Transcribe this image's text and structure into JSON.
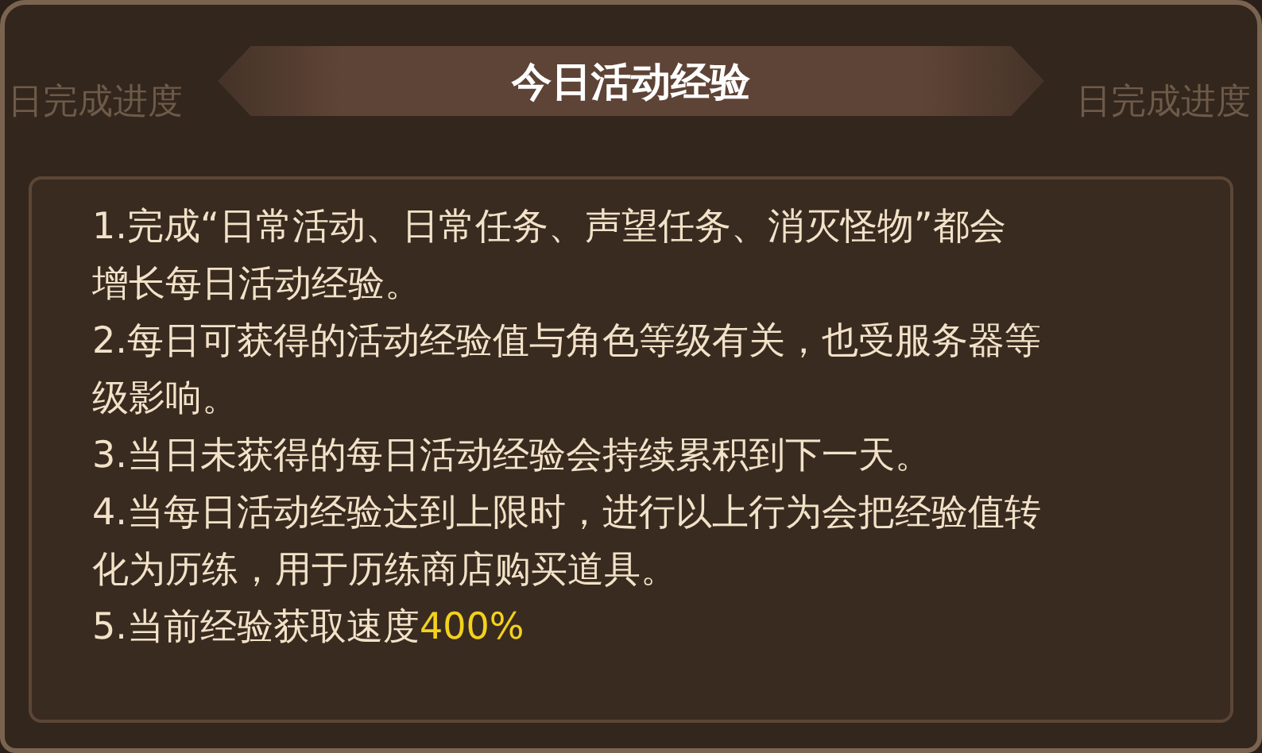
{
  "background_labels": [
    "日完成进度",
    "日完成进度"
  ],
  "dialog": {
    "title": "今日活动经验",
    "items": [
      {
        "lines": [
          "1.完成“日常活动、日常任务、声望任务、消灭怪物”都会",
          "增长每日活动经验。"
        ]
      },
      {
        "lines": [
          "2.每日可获得的活动经验值与角色等级有关，也受服务器等",
          "级影响。"
        ]
      },
      {
        "lines": [
          "3.当日未获得的每日活动经验会持续累积到下一天。"
        ]
      },
      {
        "lines": [
          "4.当每日活动经验达到上限时，进行以上行为会把经验值转",
          "化为历练，用于历练商店购买道具。"
        ]
      },
      {
        "lines": [
          "5.当前经验获取速度"
        ],
        "highlight": "400%"
      }
    ]
  }
}
